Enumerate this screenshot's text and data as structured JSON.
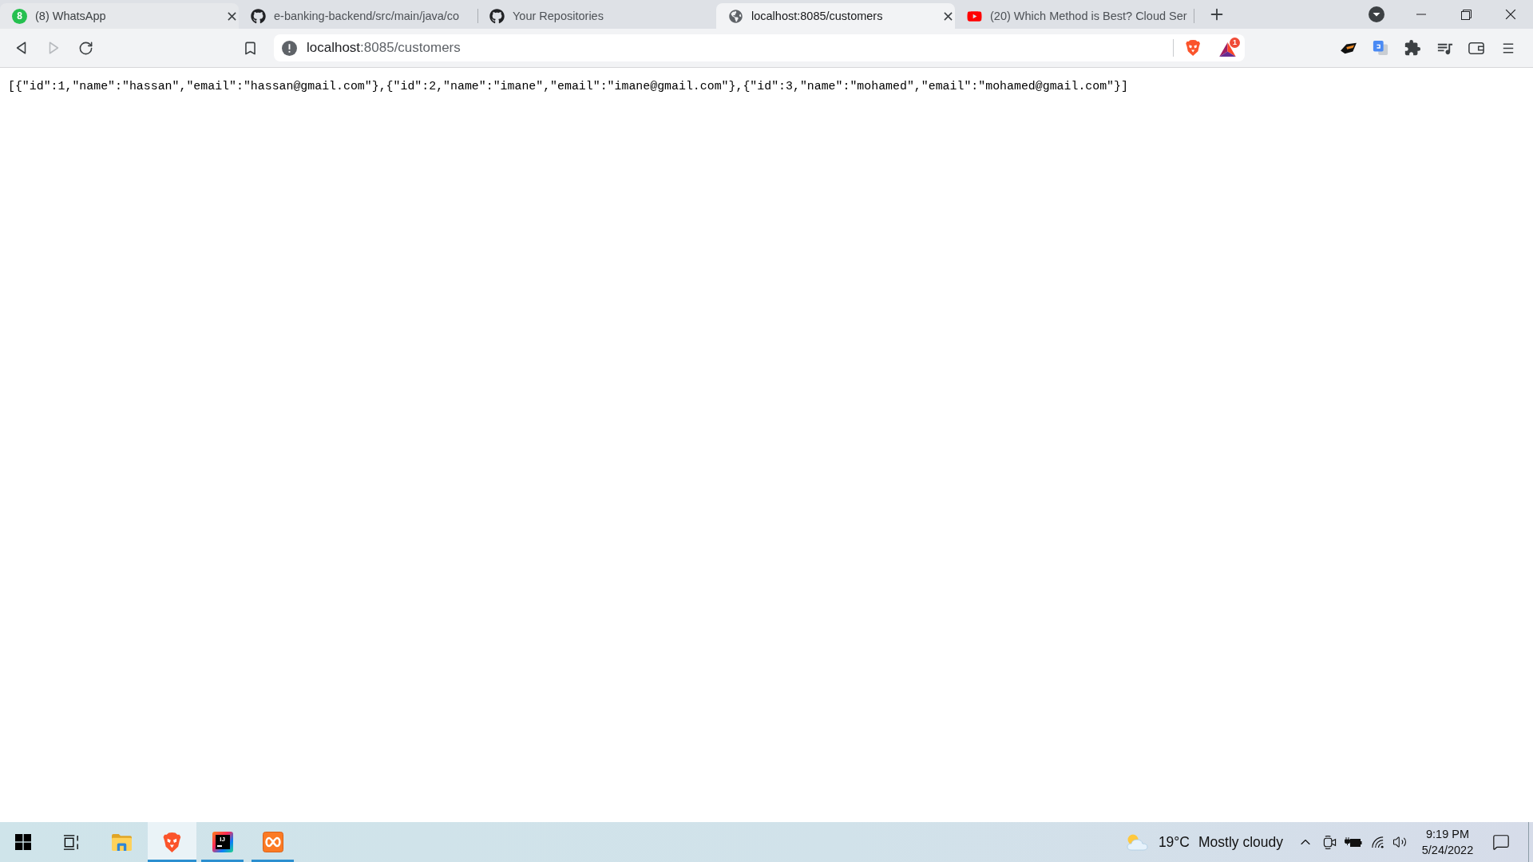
{
  "browser": {
    "tabs": [
      {
        "kind": "whatsapp",
        "badge": "8",
        "title": "(8) WhatsApp",
        "selected": false,
        "hovered": true
      },
      {
        "kind": "github",
        "title": "e-banking-backend/src/main/java/co",
        "selected": false,
        "hovered": false
      },
      {
        "kind": "github",
        "title": "Your Repositories",
        "selected": false,
        "hovered": false
      },
      {
        "kind": "globe",
        "title": "localhost:8085/customers",
        "selected": true,
        "hovered": false
      },
      {
        "kind": "youtube",
        "title": "(20) Which Method is Best? Cloud Ser",
        "selected": false,
        "hovered": false
      }
    ],
    "toolbar": {
      "nav": [
        {
          "kind": "back",
          "disabled": false
        },
        {
          "kind": "forward",
          "disabled": true
        },
        {
          "kind": "reload",
          "disabled": false
        }
      ],
      "address": {
        "host": "localhost",
        "rest": ":8085/customers"
      },
      "rewards_badge": "1"
    }
  },
  "page": {
    "body_text": "[{\"id\":1,\"name\":\"hassan\",\"email\":\"hassan@gmail.com\"},{\"id\":2,\"name\":\"imane\",\"email\":\"imane@gmail.com\"},{\"id\":3,\"name\":\"mohamed\",\"email\":\"mohamed@gmail.com\"}]"
  },
  "taskbar": {
    "apps": [
      {
        "kind": "explorer",
        "selected": false,
        "running": false
      },
      {
        "kind": "brave",
        "selected": true,
        "running": true
      },
      {
        "kind": "intellij",
        "label": "IJ",
        "selected": false,
        "running": true
      },
      {
        "kind": "xampp",
        "selected": false,
        "running": true
      }
    ],
    "weather": {
      "temperature": "19°C",
      "condition": "Mostly cloudy"
    },
    "clock": {
      "time": "9:19 PM",
      "date": "5/24/2022"
    }
  }
}
